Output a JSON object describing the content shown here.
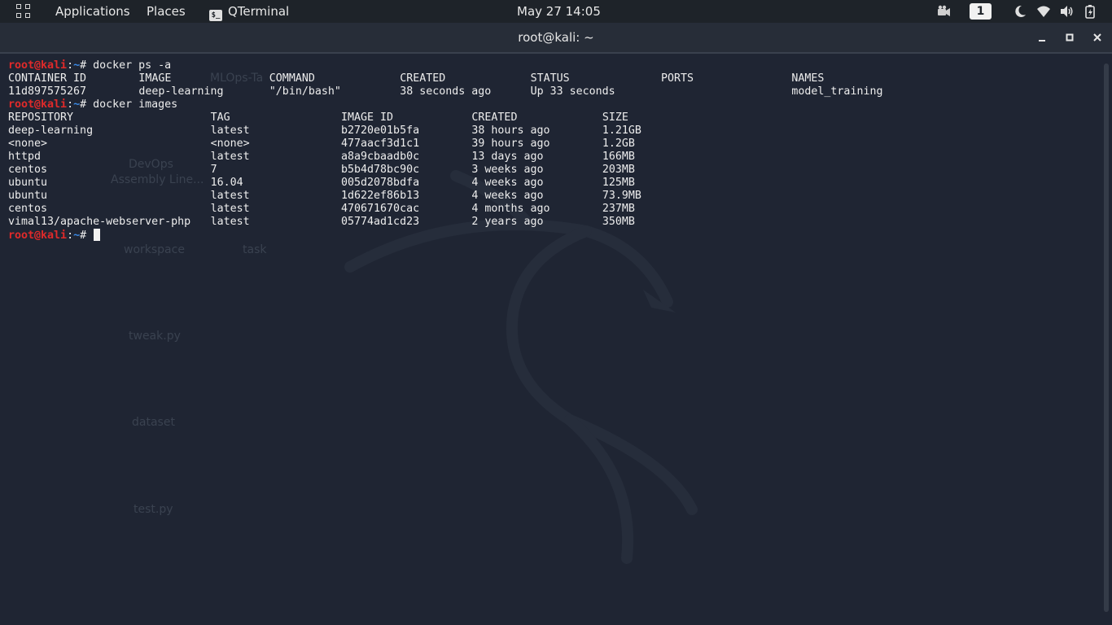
{
  "topbar": {
    "applications": "Applications",
    "places": "Places",
    "active_app": "QTerminal",
    "clock": "May 27  14:05",
    "workspace": "1"
  },
  "window": {
    "title": "root@kali: ~"
  },
  "prompt": {
    "user": "root@kali",
    "sep": ":",
    "path": "~",
    "symbol": "# "
  },
  "terminal": {
    "cmd1": "docker ps -a",
    "ps_headers": [
      "CONTAINER ID",
      "IMAGE",
      "COMMAND",
      "CREATED",
      "STATUS",
      "PORTS",
      "NAMES"
    ],
    "ps_rows": [
      [
        "11d897575267",
        "deep-learning",
        "\"/bin/bash\"",
        "38 seconds ago",
        "Up 33 seconds",
        "",
        "model_training"
      ]
    ],
    "cmd2": "docker images",
    "img_headers": [
      "REPOSITORY",
      "TAG",
      "IMAGE ID",
      "CREATED",
      "SIZE"
    ],
    "img_rows": [
      [
        "deep-learning",
        "latest",
        "b2720e01b5fa",
        "38 hours ago",
        "1.21GB"
      ],
      [
        "<none>",
        "<none>",
        "477aacf3d1c1",
        "39 hours ago",
        "1.2GB"
      ],
      [
        "httpd",
        "latest",
        "a8a9cbaadb0c",
        "13 days ago",
        "166MB"
      ],
      [
        "centos",
        "7",
        "b5b4d78bc90c",
        "3 weeks ago",
        "203MB"
      ],
      [
        "ubuntu",
        "16.04",
        "005d2078bdfa",
        "4 weeks ago",
        "125MB"
      ],
      [
        "ubuntu",
        "latest",
        "1d622ef86b13",
        "4 weeks ago",
        "73.9MB"
      ],
      [
        "centos",
        "latest",
        "470671670cac",
        "4 months ago",
        "237MB"
      ],
      [
        "vimal13/apache-webserver-php",
        "latest",
        "05774ad1cd23",
        "2 years ago",
        "350MB"
      ]
    ]
  },
  "desktop_icons": [
    "MLOps-Ta",
    "DevOps",
    "Assembly Line...",
    "workspace",
    "task",
    "tweak.py",
    "dataset",
    "test.py"
  ],
  "colors": {
    "prompt_user": "#e02a2a",
    "prompt_path": "#3b8ae6",
    "terminal_bg": "#1f2533",
    "topbar_bg": "#1e2329"
  }
}
